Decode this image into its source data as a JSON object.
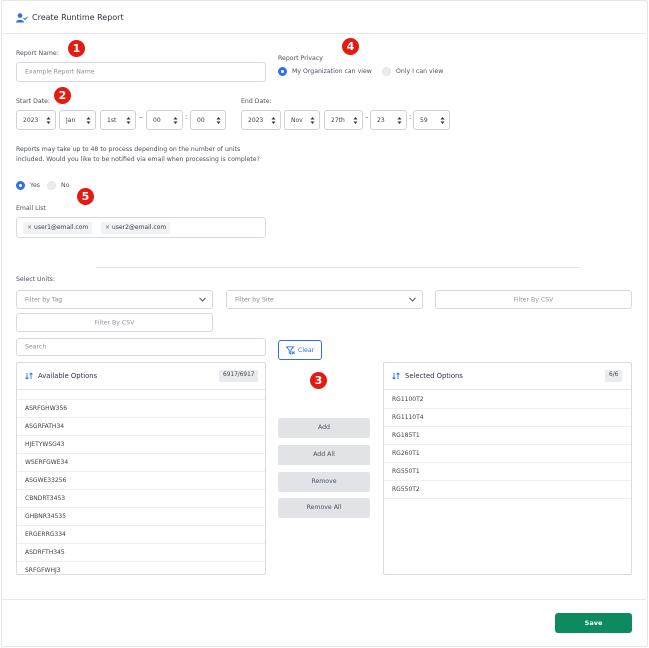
{
  "header": {
    "title": "Create Runtime Report",
    "icon": "user-check-icon"
  },
  "report_name": {
    "label": "Report Name:",
    "placeholder": "Example Report Name"
  },
  "privacy": {
    "label": "Report Privacy",
    "options": [
      "My Organization can view",
      "Only I can view"
    ],
    "selected": "My Organization can view"
  },
  "start_date": {
    "label": "Start Date:",
    "year": "2023",
    "month": "Jan",
    "day": "1st",
    "hour": "00",
    "minute": "00"
  },
  "end_date": {
    "label": "End Date:",
    "year": "2023",
    "month": "Nov",
    "day": "27th",
    "hour": "23",
    "minute": "59"
  },
  "notify": {
    "text": "Reports may take up to 48 to process depending on the number of units included. Would you like to be notified via email when processing is complete?",
    "yes": "Yes",
    "no": "No",
    "selected": "Yes"
  },
  "email_list": {
    "label": "Email List",
    "emails": [
      "user1@email.com",
      "user2@email.com"
    ]
  },
  "units": {
    "label": "Select Units:",
    "filter_tag": "Filter by Tag",
    "filter_site": "Filter by Site",
    "filter_csv_1": "Filter By CSV",
    "filter_csv_2": "Filter By CSV",
    "search_placeholder": "Search",
    "clear_label": "Clear"
  },
  "available": {
    "title": "Available Options",
    "count": "6917/6917",
    "items": [
      "ASRFGHW356",
      "ASGRFATH34",
      "HJETYWSG43",
      "WSERFGWE34",
      "ASGWE33256",
      "CBNDRT3453",
      "GHBNR34535",
      "ERGERRG334",
      "ASDRFTH345",
      "SRFGFWHJ3"
    ]
  },
  "actions": {
    "add": "Add",
    "add_all": "Add All",
    "remove": "Remove",
    "remove_all": "Remove All"
  },
  "selected": {
    "title": "Selected Options",
    "count": "6/6",
    "items": [
      "RG1100T2",
      "RG1110T4",
      "RG185T1",
      "RG260T1",
      "RG550T1",
      "RG550T2"
    ]
  },
  "badges": [
    "1",
    "2",
    "3",
    "4",
    "5"
  ],
  "colors": {
    "accent": "#2f6fed",
    "save": "#0e8a5f",
    "badge": "#e31b12"
  },
  "footer": {
    "save_label": "Save"
  }
}
